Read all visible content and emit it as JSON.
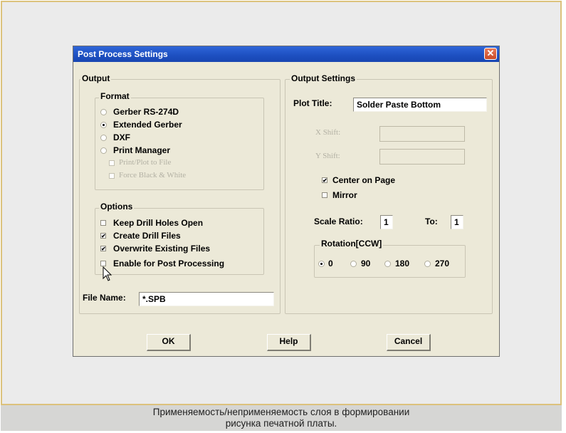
{
  "dialog": {
    "title": "Post Process Settings",
    "close_symbol": "✕"
  },
  "output": {
    "label": "Output",
    "format": {
      "label": "Format",
      "options": [
        {
          "label": "Gerber RS-274D",
          "selected": false
        },
        {
          "label": "Extended Gerber",
          "selected": true
        },
        {
          "label": "DXF",
          "selected": false
        },
        {
          "label": "Print Manager",
          "selected": false
        }
      ],
      "sub_options": [
        {
          "label": "Print/Plot to File",
          "checked": false,
          "enabled": false
        },
        {
          "label": "Force Black & White",
          "checked": false,
          "enabled": false
        }
      ]
    },
    "options": {
      "label": "Options",
      "items": [
        {
          "label": "Keep Drill Holes Open",
          "checked": false
        },
        {
          "label": "Create Drill Files",
          "checked": true
        },
        {
          "label": "Overwrite Existing Files",
          "checked": true
        },
        {
          "label": "Enable for Post Processing",
          "checked": false
        }
      ]
    },
    "file_name_label": "File Name:",
    "file_name_value": "*.SPB"
  },
  "output_settings": {
    "label": "Output Settings",
    "plot_title_label": "Plot Title:",
    "plot_title_value": "Solder Paste Bottom",
    "x_shift_label": "X Shift:",
    "y_shift_label": "Y Shift:",
    "center_on_page": {
      "label": "Center on Page",
      "checked": true
    },
    "mirror": {
      "label": "Mirror",
      "checked": false
    },
    "scale_ratio_label": "Scale Ratio:",
    "scale_ratio_value": "1",
    "to_label": "To:",
    "to_value": "1",
    "rotation": {
      "label": "Rotation[CCW]",
      "options": [
        {
          "label": "0",
          "selected": true
        },
        {
          "label": "90",
          "selected": false
        },
        {
          "label": "180",
          "selected": false
        },
        {
          "label": "270",
          "selected": false
        }
      ]
    }
  },
  "buttons": {
    "ok": "OK",
    "help": "Help",
    "cancel": "Cancel"
  },
  "caption": {
    "line1": "Применяемость/неприменяемость слоя в формировании",
    "line2": "рисунка печатной платы."
  },
  "colors": {
    "frame_border": "#dcc27c",
    "title_bar": "#2f66d9",
    "dialog_bg": "#ece9d8"
  }
}
